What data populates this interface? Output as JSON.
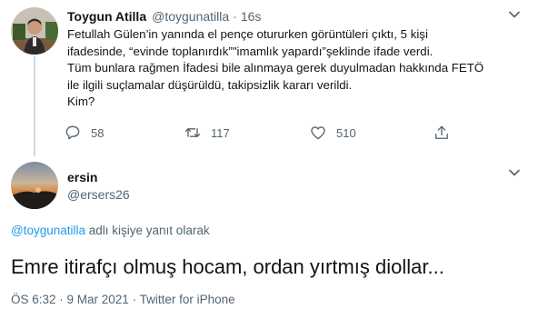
{
  "tweet": {
    "author_name": "Toygun Atilla",
    "author_handle": "@toygunatilla",
    "separator": "·",
    "time": "16s",
    "lines": [
      "Fetullah Gülen’in yanında el pençe otururken görüntüleri çıktı, 5 kişi",
      "ifadesinde, “evinde toplanırdık”\"imamlık yapardı”şeklinde ifade verdi.",
      "Tüm bunlara rağmen İfadesi bile alınmaya gerek duyulmadan hakkında FETÖ",
      "ile ilgili suçlamalar düşürüldü, takipsizlik kararı verildi.",
      "Kim?"
    ],
    "actions": {
      "replies": "58",
      "retweets": "117",
      "likes": "510"
    },
    "icons": {
      "reply": "reply-icon",
      "retweet": "retweet-icon",
      "like": "heart-icon",
      "share": "share-icon",
      "more": "more-icon"
    }
  },
  "reply": {
    "author_name": "ersin",
    "author_handle": "@ersers26",
    "reply_to_mention": "@toygunatilla",
    "reply_to_suffix": " adlı kişiye yanıt olarak",
    "text": "Emre itirafçı olmuş hocam, ordan yırtmış diollar...",
    "meta": "ÖS 6:32 · 9 Mar 2021 · Twitter for iPhone"
  },
  "colors": {
    "accent": "#1d9bf0",
    "secondary_text": "#536471",
    "primary_text": "#0f1419",
    "thread_line": "#cfd9de"
  }
}
